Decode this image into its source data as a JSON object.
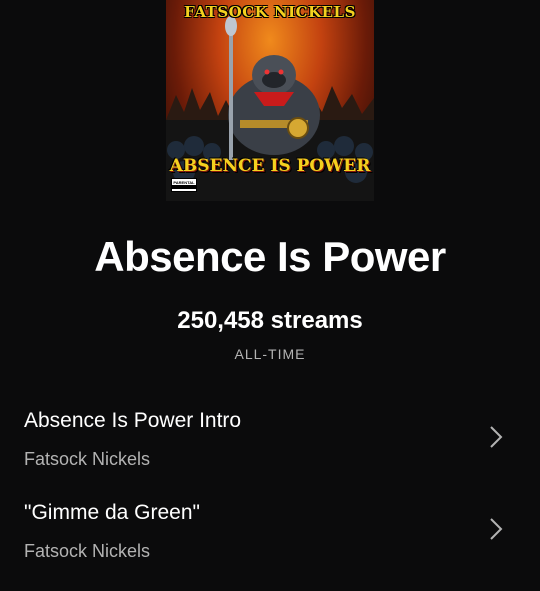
{
  "album_art": {
    "artist_text": "FATSOCK NICKELS",
    "title_text": "ABSENCE IS POWER",
    "advisory": {
      "line1": "PARENTAL",
      "line2": "ADVISORY"
    }
  },
  "album": {
    "title": "Absence Is Power",
    "streams": "250,458 streams",
    "period": "ALL-TIME"
  },
  "tracks": [
    {
      "name": "Absence Is Power Intro",
      "artist": "Fatsock Nickels"
    },
    {
      "name": "\"Gimme da Green\"",
      "artist": "Fatsock Nickels"
    }
  ],
  "colors": {
    "background": "#0b0b0c",
    "primary_text": "#ffffff",
    "secondary_text": "#b3b3b3",
    "art_yellow": "#f4d11f"
  },
  "icons": {
    "chevron": "chevron-right-icon"
  }
}
